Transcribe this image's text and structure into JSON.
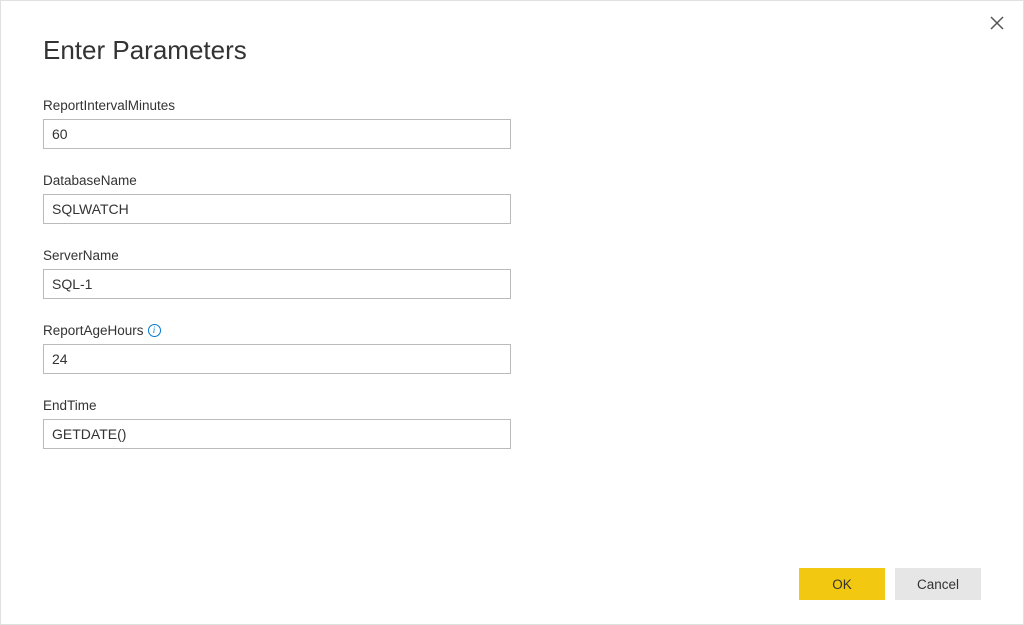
{
  "dialog": {
    "title": "Enter Parameters",
    "fields": [
      {
        "label": "ReportIntervalMinutes",
        "value": "60",
        "info": false
      },
      {
        "label": "DatabaseName",
        "value": "SQLWATCH",
        "info": false
      },
      {
        "label": "ServerName",
        "value": "SQL-1",
        "info": false
      },
      {
        "label": "ReportAgeHours",
        "value": "24",
        "info": true
      },
      {
        "label": "EndTime",
        "value": "GETDATE()",
        "info": false
      }
    ],
    "buttons": {
      "ok": "OK",
      "cancel": "Cancel"
    }
  }
}
